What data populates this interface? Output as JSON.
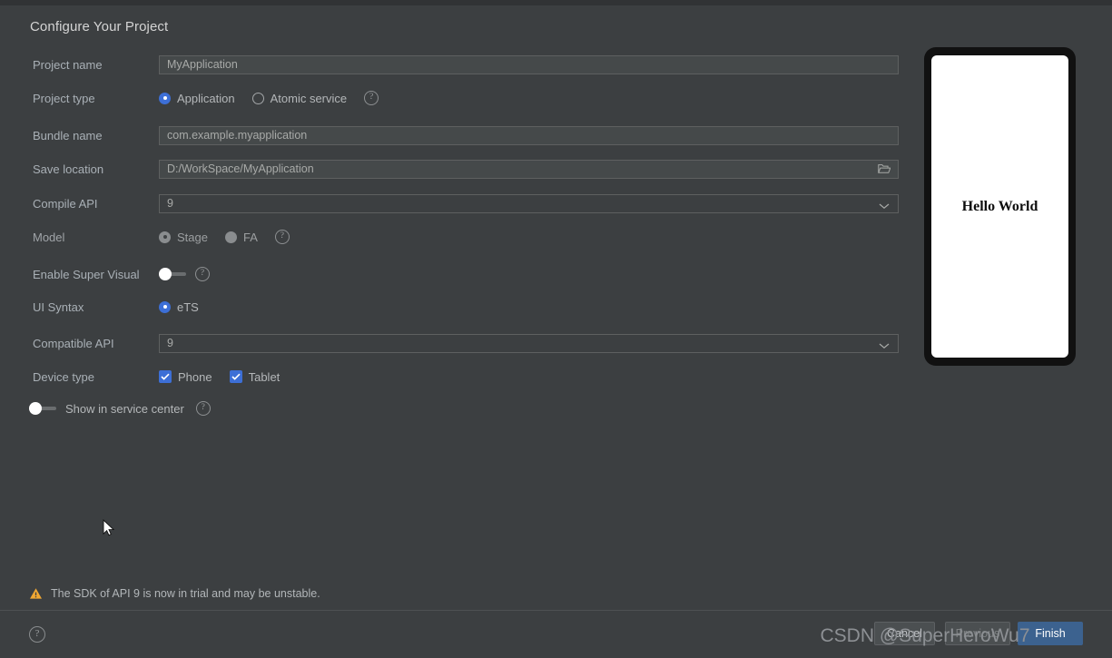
{
  "dialog": {
    "title": "Configure Your Project"
  },
  "fields": {
    "project_name": {
      "label": "Project name",
      "value": "MyApplication"
    },
    "project_type": {
      "label": "Project type",
      "options": [
        "Application",
        "Atomic service"
      ],
      "selected": "Application",
      "help": "?"
    },
    "bundle_name": {
      "label": "Bundle name",
      "value": "com.example.myapplication"
    },
    "save_location": {
      "label": "Save location",
      "value": "D:/WorkSpace/MyApplication",
      "icon": "open-folder-icon"
    },
    "compile_api": {
      "label": "Compile API",
      "value": "9",
      "icon": "chevron-down-icon"
    },
    "model": {
      "label": "Model",
      "options": [
        "Stage",
        "FA"
      ],
      "selected": "Stage",
      "help": "?"
    },
    "enable_super_visual": {
      "label": "Enable Super Visual",
      "state": "off",
      "help": "?"
    },
    "ui_syntax": {
      "label": "UI Syntax",
      "options": [
        "eTS"
      ],
      "selected": "eTS"
    },
    "compatible_api": {
      "label": "Compatible API",
      "value": "9",
      "icon": "chevron-down-icon"
    },
    "device_type": {
      "label": "Device type",
      "options": [
        {
          "label": "Phone",
          "checked": true
        },
        {
          "label": "Tablet",
          "checked": true
        }
      ]
    },
    "show_in_service_center": {
      "label": "Show in service center",
      "state": "off",
      "help": "?"
    }
  },
  "preview": {
    "text": "Hello World"
  },
  "warning": {
    "icon": "warning-triangle-icon",
    "text": "The SDK of API 9 is now in trial and may be unstable."
  },
  "footer": {
    "help": "?",
    "buttons": {
      "cancel": "Cancel",
      "previous": "Previous",
      "finish": "Finish"
    }
  },
  "watermark": {
    "text": "CSDN @SuperHeroWu7"
  },
  "colors": {
    "background": "#3c3f41",
    "accent": "#3d6fd6",
    "primary_button": "#3c628f",
    "warning": "#f0a732"
  }
}
